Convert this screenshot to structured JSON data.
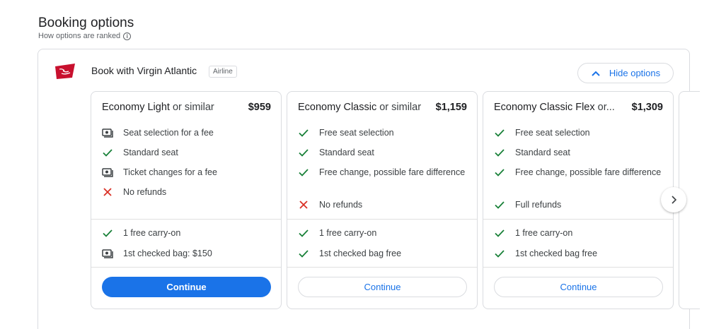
{
  "header": {
    "title": "Booking options",
    "ranked_text": "How options are ranked",
    "info_icon": "info-icon"
  },
  "provider": {
    "logo": "virgin-atlantic-logo",
    "name": "Book with Virgin Atlantic",
    "badge": "Airline",
    "hide_label": "Hide options"
  },
  "colors": {
    "accent": "#1a73e8",
    "check": "#188038",
    "cross": "#d93025",
    "fee": "#3c4043",
    "brand": "#c8102e"
  },
  "cards": [
    {
      "title": "Economy Light",
      "suffix": " or similar",
      "price": "$959",
      "features": [
        {
          "icon": "fee-icon",
          "text": "Seat selection for a fee"
        },
        {
          "icon": "check-icon",
          "text": "Standard seat"
        },
        {
          "icon": "fee-icon",
          "text": "Ticket changes for a fee"
        },
        {
          "icon": "cross-icon",
          "text": "No refunds"
        }
      ],
      "bags": [
        {
          "icon": "check-icon",
          "text": "1 free carry-on"
        },
        {
          "icon": "fee-icon",
          "text": "1st checked bag: $150"
        }
      ],
      "button": "Continue"
    },
    {
      "title": "Economy Classic",
      "suffix": " or similar",
      "price": "$1,159",
      "features": [
        {
          "icon": "check-icon",
          "text": "Free seat selection"
        },
        {
          "icon": "check-icon",
          "text": "Standard seat"
        },
        {
          "icon": "check-icon",
          "text": "Free change, possible fare difference"
        },
        {
          "icon": "cross-icon",
          "text": "No refunds"
        }
      ],
      "bags": [
        {
          "icon": "check-icon",
          "text": "1 free carry-on"
        },
        {
          "icon": "check-icon",
          "text": "1st checked bag free"
        }
      ],
      "button": "Continue"
    },
    {
      "title": "Economy Classic Flex",
      "suffix": " or...",
      "price": "$1,309",
      "features": [
        {
          "icon": "check-icon",
          "text": "Free seat selection"
        },
        {
          "icon": "check-icon",
          "text": "Standard seat"
        },
        {
          "icon": "check-icon",
          "text": "Free change, possible fare difference"
        },
        {
          "icon": "check-icon",
          "text": "Full refunds"
        }
      ],
      "bags": [
        {
          "icon": "check-icon",
          "text": "1 free carry-on"
        },
        {
          "icon": "check-icon",
          "text": "1st checked bag free"
        }
      ],
      "button": "Continue"
    }
  ],
  "next_icon": "chevron-right-icon"
}
